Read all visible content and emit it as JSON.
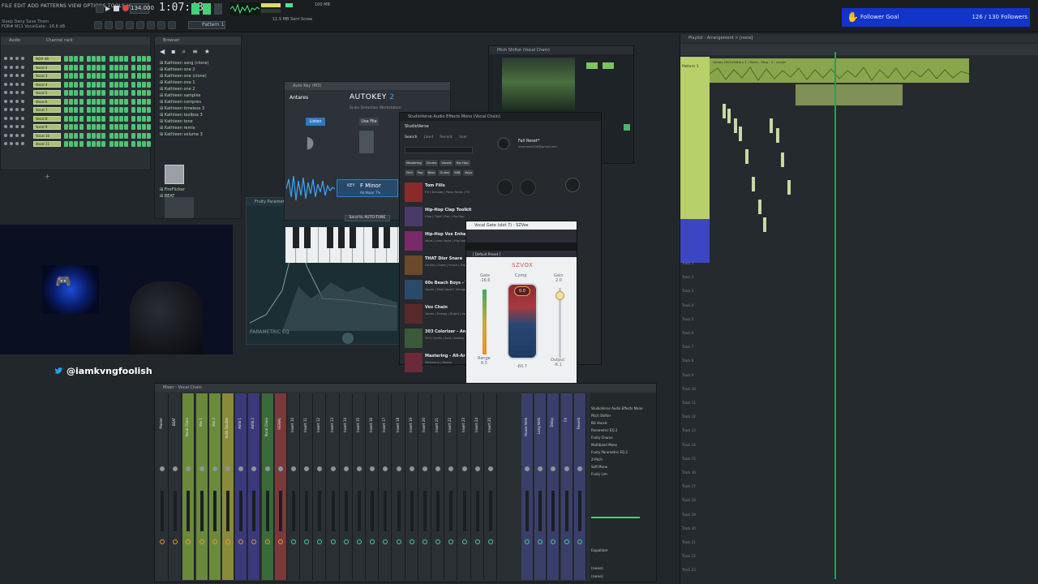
{
  "toolbar": {
    "menu_text": "FILE EDIT ADD PATTERNS VIEW OPTIONS TOOLS HELP",
    "status_lines": [
      "Sleep Deny Save Them",
      "FOR# M11 VocalGate: -16.6 dB"
    ],
    "tempo": "134.000",
    "song_time": "1:07:48",
    "pattern_label": "Pattern 1",
    "cpu_lines": [
      "11.5 MB  Sent Scree"
    ],
    "cpu_side": "100 MB"
  },
  "follower_goal": {
    "label": "Follower Goal",
    "count": "126 / 130 Followers",
    "color": "#1334c8"
  },
  "channel_rack": {
    "title": "Channel rack",
    "filter": "Audio",
    "channel_names": [
      "NO# 48",
      "Vocal 2",
      "Vocal 3",
      "Vocal 4",
      "Vocal 5",
      "Vocal 6",
      "Vocal 7",
      "Vocal 8",
      "Vocal 9",
      "Vocal 10",
      "Vocal 11"
    ]
  },
  "browser": {
    "title": "Browser",
    "items": [
      "Kathleen song (clone)",
      "Kathleen one 2",
      "Kathleen one (clone)",
      "Kathleen one 1",
      "Kathleen one 2",
      "Kathleen samples",
      "Kathleen compres",
      "Kathleen timeless 3",
      "Kathleen toolbox 3",
      "Kathleen tone",
      "Kathleen remix",
      "Kathleen volume 3",
      "FireFlicker",
      "BEAT"
    ]
  },
  "streamer": {
    "handle": "@iamkvngfoolish"
  },
  "eq_plugin": {
    "title": "Fruity Parametric EQ 2",
    "footer": "PARAMETRIC EQ"
  },
  "autokey": {
    "window_title": "Auto Key (M3)",
    "brand": "Antares",
    "name": "AUTOKEY",
    "version": "2",
    "subtitle": "Scale Detection Workstation",
    "btn_listen": "Listen",
    "btn_use_file": "Use File",
    "key_label": "KEY",
    "key_value": "F Minor",
    "key_sub": "Ab Major  7%",
    "send_button": "Send to AUTO-TUNE"
  },
  "studioverse": {
    "window_title": "StudioVerse Audio Effects Mono (Vocal Chain)",
    "brand": "StudioVerse",
    "nav_tabs": [
      "Search",
      "Liked",
      "Recent",
      "User"
    ],
    "genre_chips": [
      "Mastering",
      "Drums",
      "Vocals",
      "Hip Hop",
      "Drill",
      "Pop",
      "Bass",
      "Guitar",
      "808",
      "Keys"
    ],
    "preset_name": "Fall Reset*",
    "preset_author": "tammame026@gmail.com",
    "chains": [
      {
        "name": "Tom Fills",
        "sub": "P.E | Decode | Piano Tones | P.E"
      },
      {
        "name": "Hip-Hop Clap Toolkit",
        "sub": "Clap | Tight | Pop | Hip-Hop"
      },
      {
        "name": "Hip-Hop Vox Enhancer",
        "sub": "Vocal | Lead Vocal | Hip-Hop"
      },
      {
        "name": "THAT Dior Snare",
        "sub": "Drums | Snare | Punch | Trap"
      },
      {
        "name": "60s Beach Boys - Vi",
        "sub": "Vocals | Male Vocal | Vintage"
      },
      {
        "name": "Vox Chain",
        "sub": "Vocals | Energy | Bright | Vox"
      },
      {
        "name": "303 Colorizer - Analog",
        "sub": "303 | Synth | Acid | Analog"
      },
      {
        "name": "Mastering - All-Around",
        "sub": "Mastering | Master"
      }
    ]
  },
  "pitcher": {
    "title": "Pitch Shifter (Vocal Chain)"
  },
  "gate": {
    "window_title": "Vocal Gate (slot 7) - SZVox",
    "brand": "SZVOX",
    "preset": "[ Default Preset ]",
    "gate_label": "Gate",
    "gate_value": "-16.6",
    "comp_label": "Comp",
    "comp_value": "0.0",
    "gain_label": "Gain",
    "gain_value": "2.0",
    "range_label": "Range",
    "range_value": "6.5",
    "output_label": "Output",
    "output_value": "-6.1",
    "meter_value": "-60.7"
  },
  "playlist": {
    "title": "Playlist - Arrangement > [none]",
    "pattern_label": "Pattern 1",
    "clip_label": "Vocals 2023-Pattern 1 - Rules - Stop - 4 - vocals",
    "tracks": [
      "Track 1",
      "Track 2",
      "Track 3",
      "Track 4",
      "Track 5",
      "Track 6",
      "Track 7",
      "Track 8",
      "Track 9",
      "Track 10",
      "Track 11",
      "Track 12",
      "Track 13",
      "Track 14",
      "Track 15",
      "Track 16",
      "Track 17",
      "Track 18",
      "Track 19",
      "Track 20",
      "Track 21",
      "Track 22",
      "Track 23"
    ]
  },
  "mixer": {
    "title": "Mixer - Vocal Chain",
    "strip_names": [
      "Master",
      "BEAT",
      "Vocal Chain",
      "Vox 1",
      "Vox 2",
      "Adlib Double",
      "Adlib 1",
      "Adlib 2",
      "Vocal Chain",
      "SIGNAL",
      "Insert 10",
      "Insert 11",
      "Insert 12",
      "Insert 13",
      "Insert 14",
      "Insert 15",
      "Insert 16",
      "Insert 17",
      "Insert 18",
      "Insert 19",
      "Insert 20",
      "Insert 21",
      "Insert 22",
      "Insert 23",
      "Insert 24",
      "Insert 25",
      "House Verb",
      "Long Verb",
      "Delay",
      "FX",
      "Reverb"
    ],
    "fx_slots": [
      "StudioVerse Audio Effects Mono",
      "Pitch Shifter",
      "BG Vocals",
      "Parametric EQ 2",
      "Fruity Chorus",
      "Multiband Mono",
      "Fruity Parametric EQ 2",
      "Z-Pitch",
      "Soft Mono",
      "Fruity Lim"
    ],
    "eq_label": "Equalizer",
    "out_slots": [
      "(none)",
      "(none)"
    ]
  }
}
